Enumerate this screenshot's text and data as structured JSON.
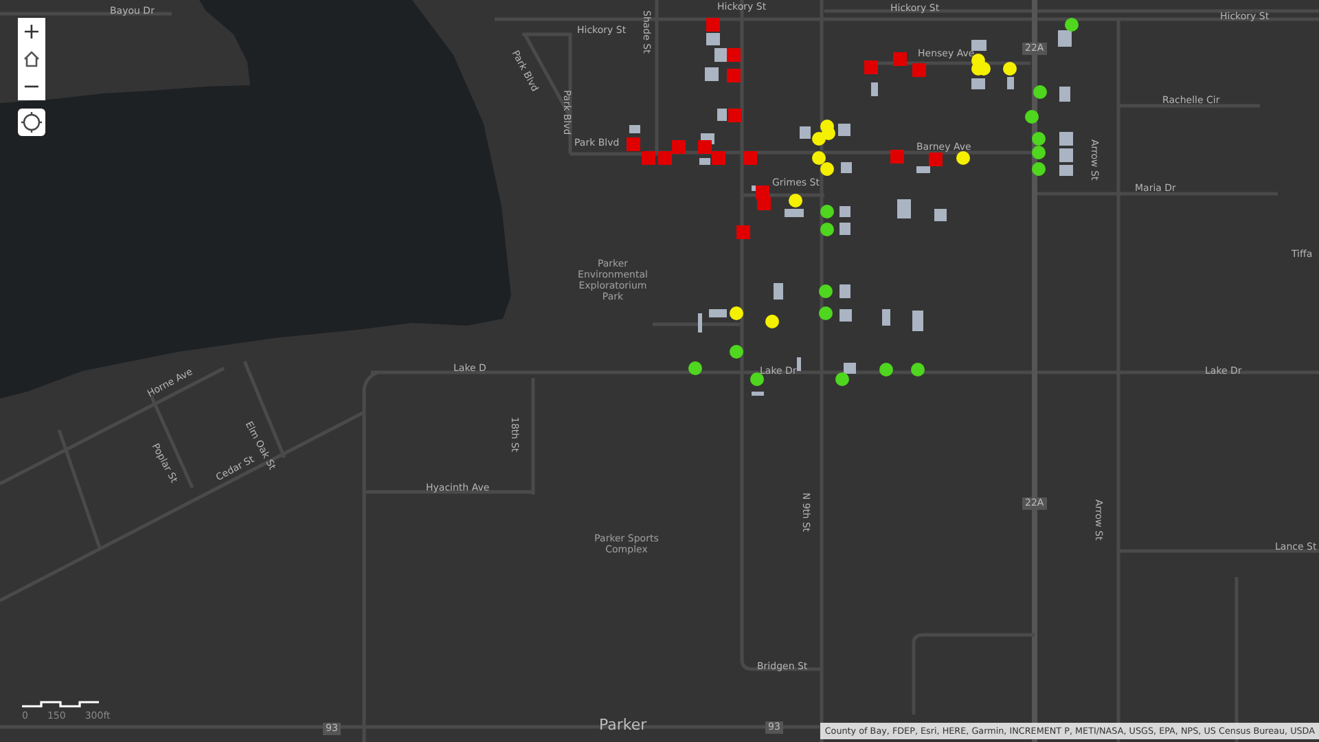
{
  "zoom_controls": {
    "zoom_in": "+",
    "zoom_out": "−"
  },
  "labels": [
    {
      "text": "Bayou Dr"
    },
    {
      "text": "Hickory St"
    },
    {
      "text": "Shade St"
    },
    {
      "text": "Hickory St"
    },
    {
      "text": "Hickory St"
    },
    {
      "text": "Hickory St"
    },
    {
      "text": "Park Blvd"
    },
    {
      "text": "Park Blvd"
    },
    {
      "text": "Park Blvd"
    },
    {
      "text": "Hensey Ave"
    },
    {
      "text": "Barney Ave"
    },
    {
      "text": "Rachelle Cir"
    },
    {
      "text": "Arrow St"
    },
    {
      "text": "Maria Dr"
    },
    {
      "text": "Tiffa"
    },
    {
      "text": "Grimes St"
    },
    {
      "text": "Parker Environmental Exploratorium Park"
    },
    {
      "text": "Lake D"
    },
    {
      "text": "Lake Dr"
    },
    {
      "text": "Lake Dr"
    },
    {
      "text": "Horne Ave"
    },
    {
      "text": "Elm Oak St"
    },
    {
      "text": "Poplar St"
    },
    {
      "text": "Cedar St"
    },
    {
      "text": "18th St"
    },
    {
      "text": "Hyacinth Ave"
    },
    {
      "text": "Parker Sports Complex"
    },
    {
      "text": "N 9th St"
    },
    {
      "text": "Arrow St"
    },
    {
      "text": "Lance St"
    },
    {
      "text": "Bridgen St"
    }
  ],
  "place_label": "Parker",
  "route_shields": [
    "22A",
    "22A",
    "93",
    "93"
  ],
  "markers": [
    {
      "kind": "square",
      "color": "#e00000"
    },
    {
      "kind": "square",
      "color": "#e00000"
    },
    {
      "kind": "square",
      "color": "#e00000"
    },
    {
      "kind": "square",
      "color": "#e00000"
    },
    {
      "kind": "square",
      "color": "#e00000"
    },
    {
      "kind": "square",
      "color": "#e00000"
    },
    {
      "kind": "square",
      "color": "#e00000"
    },
    {
      "kind": "square",
      "color": "#e00000"
    },
    {
      "kind": "square",
      "color": "#e00000"
    },
    {
      "kind": "square",
      "color": "#e00000"
    },
    {
      "kind": "square",
      "color": "#e00000"
    },
    {
      "kind": "square",
      "color": "#e00000"
    },
    {
      "kind": "square",
      "color": "#e00000"
    },
    {
      "kind": "square",
      "color": "#e00000"
    },
    {
      "kind": "square",
      "color": "#e00000"
    },
    {
      "kind": "square",
      "color": "#e00000"
    },
    {
      "kind": "square",
      "color": "#e00000"
    },
    {
      "kind": "square",
      "color": "#e00000"
    },
    {
      "kind": "square",
      "color": "#e00000"
    },
    {
      "kind": "circle",
      "color": "#f5f000"
    },
    {
      "kind": "circle",
      "color": "#f5f000"
    },
    {
      "kind": "circle",
      "color": "#f5f000"
    },
    {
      "kind": "circle",
      "color": "#f5f000"
    },
    {
      "kind": "circle",
      "color": "#f5f000"
    },
    {
      "kind": "circle",
      "color": "#f5f000"
    },
    {
      "kind": "circle",
      "color": "#f5f000"
    },
    {
      "kind": "circle",
      "color": "#f5f000"
    },
    {
      "kind": "circle",
      "color": "#f5f000"
    },
    {
      "kind": "circle",
      "color": "#f5f000"
    },
    {
      "kind": "circle",
      "color": "#f5f000"
    },
    {
      "kind": "circle",
      "color": "#f5f000"
    },
    {
      "kind": "circle",
      "color": "#f5f000"
    },
    {
      "kind": "circle",
      "color": "#4fd61e"
    },
    {
      "kind": "circle",
      "color": "#4fd61e"
    },
    {
      "kind": "circle",
      "color": "#4fd61e"
    },
    {
      "kind": "circle",
      "color": "#4fd61e"
    },
    {
      "kind": "circle",
      "color": "#4fd61e"
    },
    {
      "kind": "circle",
      "color": "#4fd61e"
    },
    {
      "kind": "circle",
      "color": "#4fd61e"
    },
    {
      "kind": "circle",
      "color": "#4fd61e"
    },
    {
      "kind": "circle",
      "color": "#4fd61e"
    },
    {
      "kind": "circle",
      "color": "#4fd61e"
    },
    {
      "kind": "circle",
      "color": "#4fd61e"
    },
    {
      "kind": "circle",
      "color": "#4fd61e"
    },
    {
      "kind": "circle",
      "color": "#4fd61e"
    },
    {
      "kind": "circle",
      "color": "#4fd61e"
    },
    {
      "kind": "circle",
      "color": "#4fd61e"
    },
    {
      "kind": "circle",
      "color": "#4fd61e"
    }
  ],
  "scale_bar": {
    "ticks": [
      "0",
      "150",
      "300ft"
    ]
  },
  "attribution": "County of Bay, FDEP, Esri, HERE, Garmin, INCREMENT P, METI/NASA, USGS, EPA, NPS, US Census Bureau, USDA"
}
